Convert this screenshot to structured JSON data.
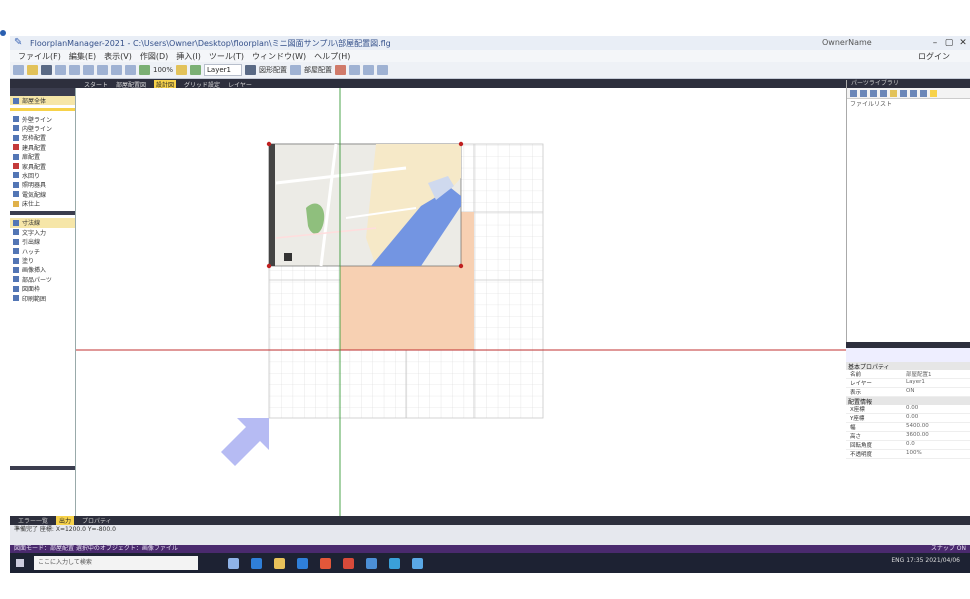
{
  "window": {
    "title": "FloorplanManager-2021 - C:\\Users\\Owner\\Desktop\\floorplan\\ミニ図面サンプル\\部屋配置図.flg",
    "user": "OwnerName",
    "min": "–",
    "max": "▢",
    "close": "✕"
  },
  "menus": [
    "ファイル(F)",
    "編集(E)",
    "表示(V)",
    "作図(D)",
    "挿入(I)",
    "ツール(T)",
    "ウィンドウ(W)",
    "ヘルプ(H)"
  ],
  "menubar_right": "ログイン",
  "toolbar": {
    "zoom_label": "100%",
    "layer_select": "Layer1",
    "extra1": "図形配置",
    "extra2": "部屋配置"
  },
  "canvas_tabs": [
    "スタート",
    "部屋配置図",
    "設計図",
    "グリッド設定",
    "レイヤー"
  ],
  "left_panel": {
    "items_a": [
      "部屋全体",
      "外壁ライン",
      "内壁ライン",
      "窓枠配置",
      "建具配置",
      "扉配置",
      "家具配置",
      "水回り",
      "照明器具",
      "電気配線",
      "床仕上"
    ],
    "items_b": [
      "寸法線",
      "文字入力",
      "引出線",
      "ハッチ",
      "塗り",
      "画像挿入",
      "部品パーツ",
      "図面枠",
      "印刷範囲"
    ]
  },
  "right_panel": {
    "title": "パーツライブラリ",
    "subtitle": "ファイルリスト"
  },
  "props": {
    "group1": "基本プロパティ",
    "rows1": [
      [
        "名前",
        "部屋配置1"
      ],
      [
        "レイヤー",
        "Layer1"
      ],
      [
        "表示",
        "ON"
      ]
    ],
    "group2": "配置情報",
    "rows2": [
      [
        "X座標",
        "0.00"
      ],
      [
        "Y座標",
        "0.00"
      ],
      [
        "幅",
        "5400.00"
      ],
      [
        "高さ",
        "3600.00"
      ],
      [
        "回転角度",
        "0.0"
      ],
      [
        "不透明度",
        "100%"
      ]
    ]
  },
  "status_tabs": [
    "エラー一覧",
    "出力",
    "プロパティ"
  ],
  "info_text": "準備完了  座標: X=1200.0  Y=-800.0",
  "status_text": "図面モード：部屋配置  選択中のオブジェクト：画像ファイル",
  "status_right": "スナップ ON",
  "taskbar": {
    "search_placeholder": "ここに入力して検索",
    "tray": "ENG 17:35 2021/04/06"
  },
  "colors": {
    "peach": "#f7d0b2",
    "blue_water": "#6f93e0",
    "arrow": "#b6bbf3",
    "axis_green": "#3a9a3a",
    "axis_red": "#c03030"
  }
}
